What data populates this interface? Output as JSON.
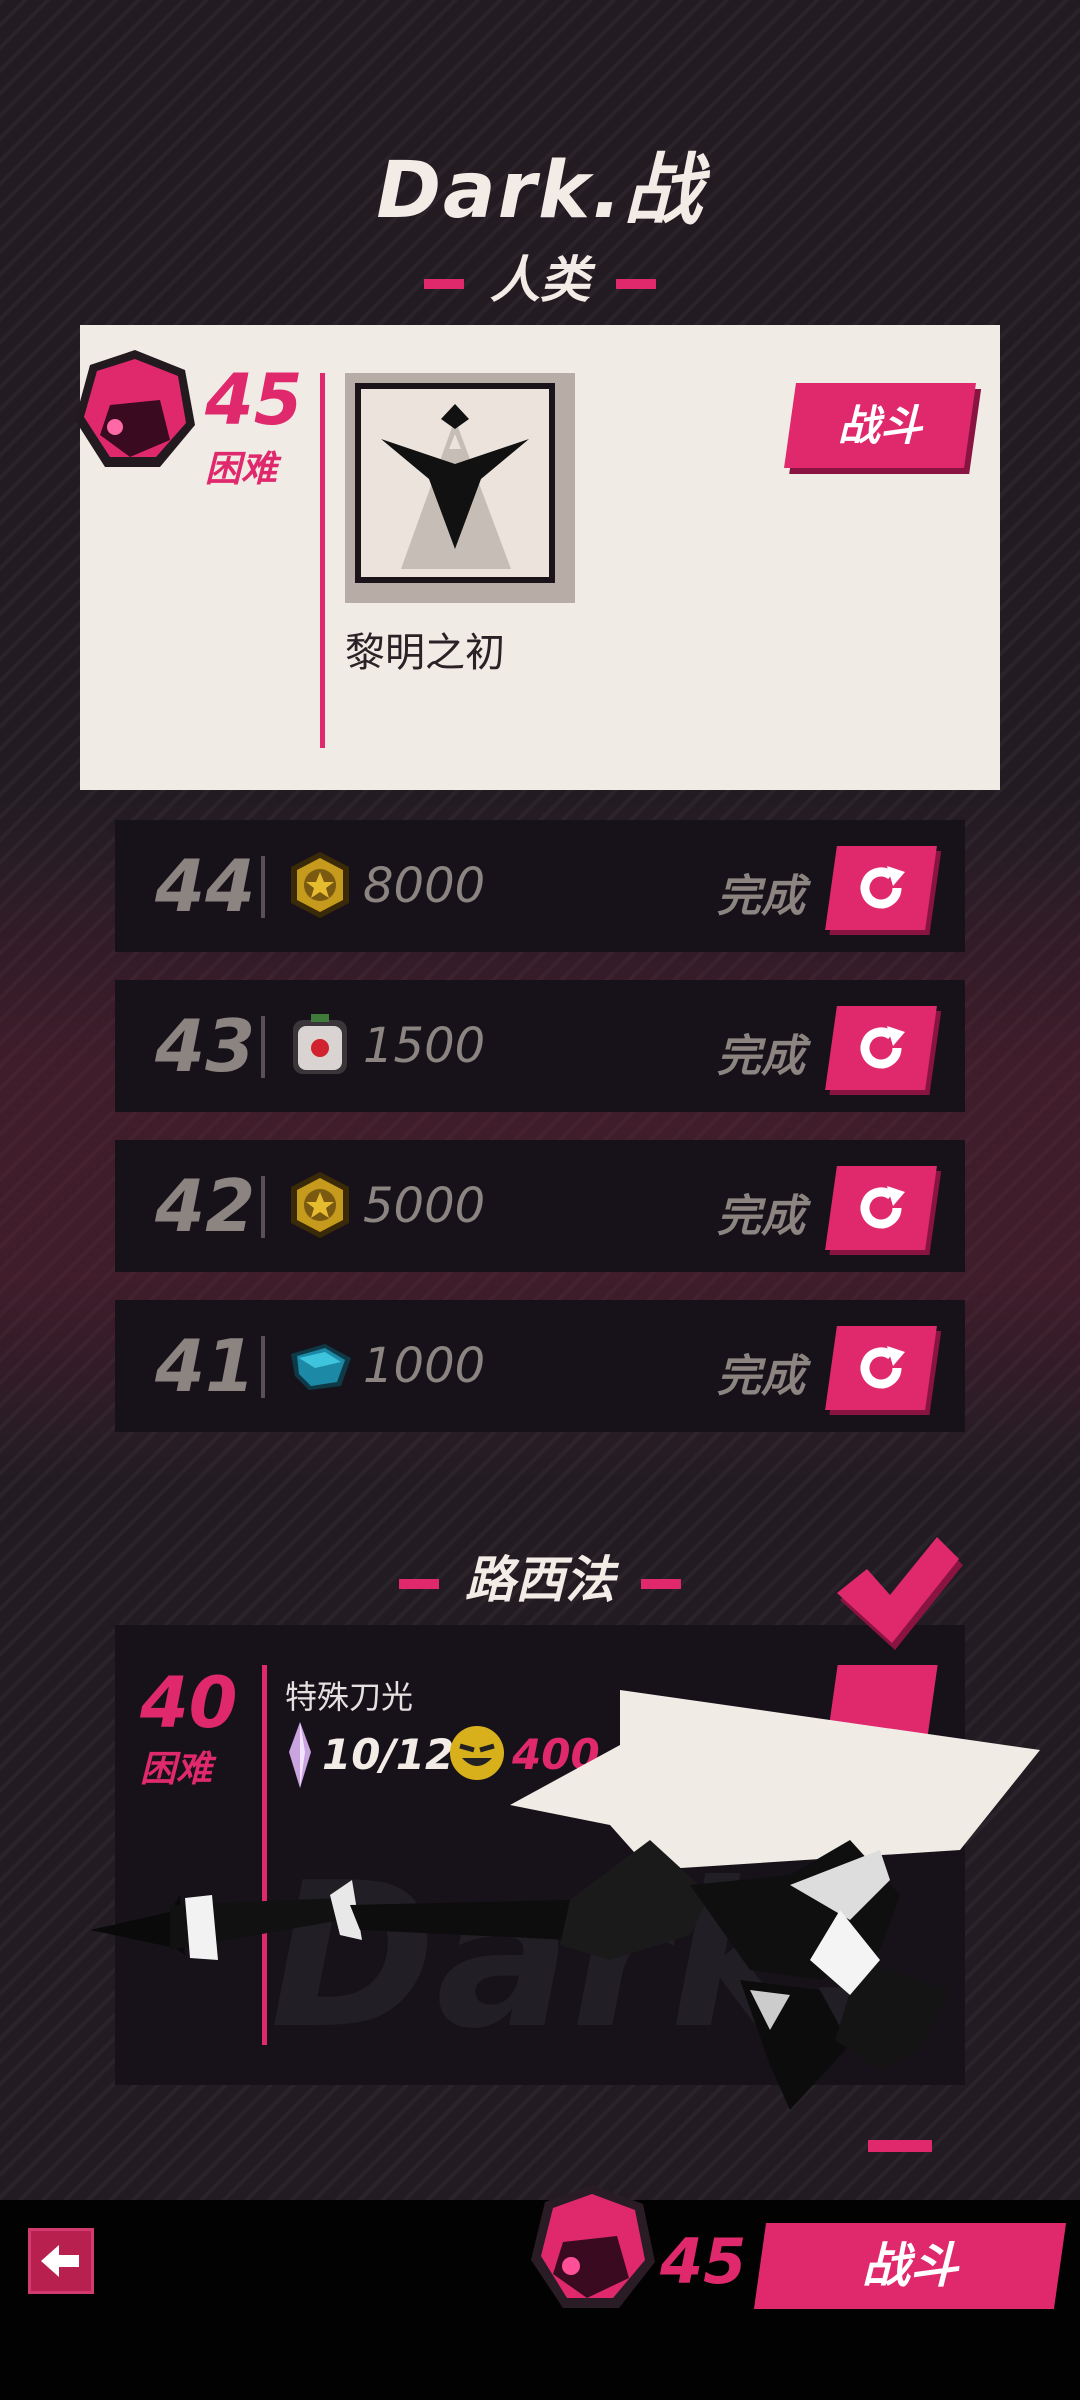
{
  "header": {
    "title": "Dark.战"
  },
  "section_human": {
    "label": "人类"
  },
  "current_stage": {
    "level": "45",
    "difficulty": "困难",
    "stage_name": "黎明之初",
    "fight_label": "战斗"
  },
  "completed_rows": [
    {
      "level": "44",
      "reward_icon": "gold-coin-icon",
      "amount": "8000",
      "status": "完成"
    },
    {
      "level": "43",
      "reward_icon": "robot-head-icon",
      "amount": "1500",
      "status": "完成"
    },
    {
      "level": "42",
      "reward_icon": "gold-coin-icon",
      "amount": "5000",
      "status": "完成"
    },
    {
      "level": "41",
      "reward_icon": "blue-crystal-icon",
      "amount": "1000",
      "status": "完成"
    }
  ],
  "section_lucifer": {
    "label": "路西法"
  },
  "stage_40": {
    "level": "40",
    "difficulty": "困难",
    "reward_name": "特殊刀光",
    "pieces": "10/12",
    "coins": "400",
    "watermark": "Dark."
  },
  "bottom_bar": {
    "level": "45",
    "fight_label": "战斗"
  },
  "colors": {
    "accent": "#e0296d",
    "card": "#f1ebe5",
    "row": "#17121a"
  }
}
